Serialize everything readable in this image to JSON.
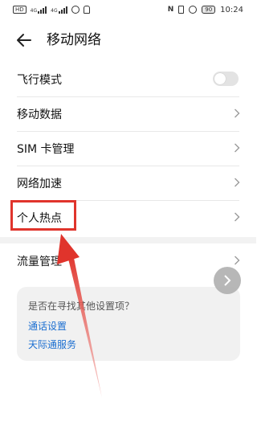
{
  "status_bar": {
    "left_chip": "HD",
    "sig1_label": "4G",
    "sig2_label": "4G",
    "nfc": "N",
    "battery": "90",
    "time": "10:24"
  },
  "header": {
    "title": "移动网络"
  },
  "settings": {
    "airplane_mode": "飞行模式",
    "mobile_data": "移动数据",
    "sim_management": "SIM 卡管理",
    "network_acceleration": "网络加速",
    "personal_hotspot": "个人热点",
    "data_usage": "流量管理"
  },
  "toggle_state": {
    "airplane_mode": false
  },
  "suggestion": {
    "question": "是否在寻找其他设置项？",
    "link_call_settings": "通话设置",
    "link_tianjitong": "天际通服务"
  },
  "colors": {
    "accent_link": "#1c6fd1",
    "annotation_red": "#e0342c"
  }
}
